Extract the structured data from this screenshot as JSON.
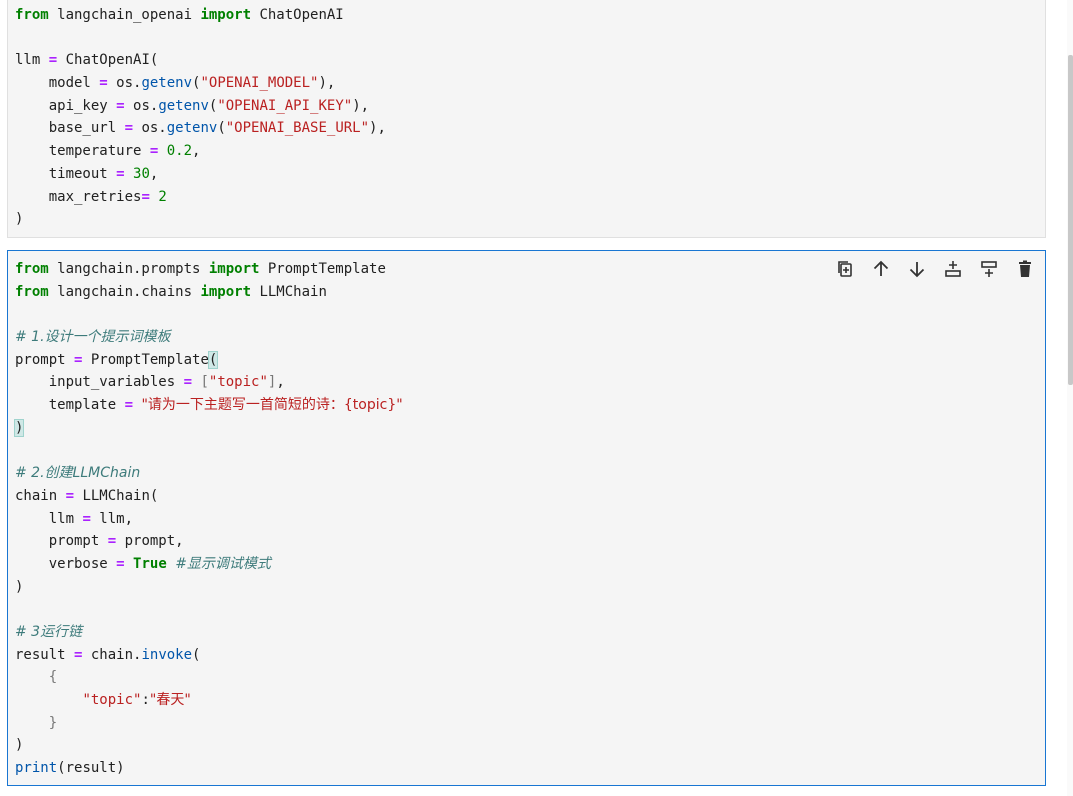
{
  "cells": [
    {
      "lines": [
        [
          [
            "kw",
            "from"
          ],
          [
            "t",
            " langchain_openai "
          ],
          [
            "kw",
            "import"
          ],
          [
            "t",
            " ChatOpenAI"
          ]
        ],
        [],
        [
          [
            "t",
            "llm "
          ],
          [
            "op",
            "="
          ],
          [
            "t",
            " ChatOpenAI("
          ]
        ],
        [
          [
            "t",
            "    model "
          ],
          [
            "op",
            "="
          ],
          [
            "t",
            " os."
          ],
          [
            "fn",
            "getenv"
          ],
          [
            "t",
            "("
          ],
          [
            "str",
            "\"OPENAI_MODEL\""
          ],
          [
            "t",
            "),"
          ]
        ],
        [
          [
            "t",
            "    api_key "
          ],
          [
            "op",
            "="
          ],
          [
            "t",
            " os."
          ],
          [
            "fn",
            "getenv"
          ],
          [
            "t",
            "("
          ],
          [
            "str",
            "\"OPENAI_API_KEY\""
          ],
          [
            "t",
            "),"
          ]
        ],
        [
          [
            "t",
            "    base_url "
          ],
          [
            "op",
            "="
          ],
          [
            "t",
            " os."
          ],
          [
            "fn",
            "getenv"
          ],
          [
            "t",
            "("
          ],
          [
            "str",
            "\"OPENAI_BASE_URL\""
          ],
          [
            "t",
            "),"
          ]
        ],
        [
          [
            "t",
            "    temperature "
          ],
          [
            "op",
            "="
          ],
          [
            "t",
            " "
          ],
          [
            "num",
            "0.2"
          ],
          [
            "t",
            ","
          ]
        ],
        [
          [
            "t",
            "    timeout "
          ],
          [
            "op",
            "="
          ],
          [
            "t",
            " "
          ],
          [
            "num",
            "30"
          ],
          [
            "t",
            ","
          ]
        ],
        [
          [
            "t",
            "    max_retries"
          ],
          [
            "op",
            "="
          ],
          [
            "t",
            " "
          ],
          [
            "num",
            "2"
          ]
        ],
        [
          [
            "t",
            ")"
          ]
        ]
      ]
    },
    {
      "lines": [
        [
          [
            "kw",
            "from"
          ],
          [
            "t",
            " langchain.prompts "
          ],
          [
            "kw",
            "import"
          ],
          [
            "t",
            " PromptTemplate"
          ]
        ],
        [
          [
            "kw",
            "from"
          ],
          [
            "t",
            " langchain.chains "
          ],
          [
            "kw",
            "import"
          ],
          [
            "t",
            " LLMChain"
          ]
        ],
        [],
        [
          [
            "cm",
            "# 1.设计一个提示词模板"
          ]
        ],
        [
          [
            "t",
            "prompt "
          ],
          [
            "op",
            "="
          ],
          [
            "t",
            " PromptTemplate"
          ],
          [
            "mb",
            "("
          ]
        ],
        [
          [
            "t",
            "    input_variables "
          ],
          [
            "op",
            "="
          ],
          [
            "t",
            " "
          ],
          [
            "brk",
            "["
          ],
          [
            "str",
            "\"topic\""
          ],
          [
            "brk",
            "]"
          ],
          [
            "t",
            ","
          ]
        ],
        [
          [
            "t",
            "    template "
          ],
          [
            "op",
            "="
          ],
          [
            "t",
            " "
          ],
          [
            "str",
            "\"请为一下主题写一首简短的诗：{topic}\""
          ]
        ],
        [
          [
            "mb",
            ")"
          ]
        ],
        [],
        [
          [
            "cm",
            "# 2.创建LLMChain"
          ]
        ],
        [
          [
            "t",
            "chain "
          ],
          [
            "op",
            "="
          ],
          [
            "t",
            " LLMChain("
          ]
        ],
        [
          [
            "t",
            "    llm "
          ],
          [
            "op",
            "="
          ],
          [
            "t",
            " llm,"
          ]
        ],
        [
          [
            "t",
            "    prompt "
          ],
          [
            "op",
            "="
          ],
          [
            "t",
            " prompt,"
          ]
        ],
        [
          [
            "t",
            "    verbose "
          ],
          [
            "op",
            "="
          ],
          [
            "t",
            " "
          ],
          [
            "kw",
            "True"
          ],
          [
            "t",
            " "
          ],
          [
            "cm",
            "#显示调试模式"
          ]
        ],
        [
          [
            "t",
            ")"
          ]
        ],
        [],
        [
          [
            "cm",
            "# 3运行链"
          ]
        ],
        [
          [
            "t",
            "result "
          ],
          [
            "op",
            "="
          ],
          [
            "t",
            " chain."
          ],
          [
            "fn",
            "invoke"
          ],
          [
            "t",
            "("
          ]
        ],
        [
          [
            "t",
            "    "
          ],
          [
            "brk",
            "{"
          ]
        ],
        [
          [
            "t",
            "        "
          ],
          [
            "str",
            "\"topic\""
          ],
          [
            "t",
            ":"
          ],
          [
            "str",
            "\"春天\""
          ]
        ],
        [
          [
            "t",
            "    "
          ],
          [
            "brk",
            "}"
          ]
        ],
        [
          [
            "t",
            ")"
          ]
        ],
        [
          [
            "fn",
            "print"
          ],
          [
            "t",
            "(result)"
          ]
        ]
      ]
    }
  ],
  "toolbar": [
    {
      "name": "duplicate-cell-icon",
      "title": "Create a duplicate of this cell below"
    },
    {
      "name": "move-up-icon",
      "title": "Move this cell up"
    },
    {
      "name": "move-down-icon",
      "title": "Move this cell down"
    },
    {
      "name": "insert-above-icon",
      "title": "Add a new cell above"
    },
    {
      "name": "insert-below-icon",
      "title": "Add a new cell below"
    },
    {
      "name": "delete-cell-icon",
      "title": "Delete this cell"
    }
  ],
  "colors": {
    "active_border": "#1976d2",
    "keyword": "#008000",
    "operator": "#aa22ff",
    "string": "#ba2121",
    "comment": "#3d7b7b"
  }
}
